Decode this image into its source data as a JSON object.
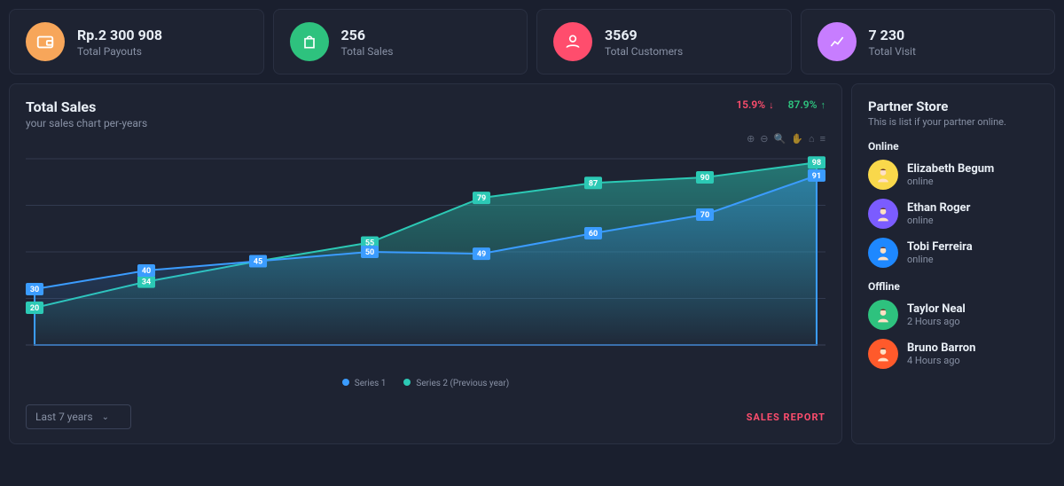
{
  "stats": [
    {
      "value": "Rp.2 300 908",
      "label": "Total Payouts",
      "icon": "wallet",
      "bg": "#f7a65a"
    },
    {
      "value": "256",
      "label": "Total Sales",
      "icon": "bag",
      "bg": "#2ec27e"
    },
    {
      "value": "3569",
      "label": "Total Customers",
      "icon": "user",
      "bg": "#ff4d6d"
    },
    {
      "value": "7 230",
      "label": "Total Visit",
      "icon": "chart",
      "bg": "#c77dff"
    }
  ],
  "chart": {
    "title": "Total Sales",
    "subtitle": "your sales chart per-years",
    "stat_down": "15.9%",
    "stat_up": "87.9%",
    "legend": {
      "series1": "Series 1",
      "series2": "Series 2 (Previous year)"
    },
    "period_selector": "Last 7 years",
    "report_link": "SALES REPORT"
  },
  "chart_data": {
    "type": "area",
    "x": [
      1,
      2,
      3,
      4,
      5,
      6,
      7,
      8
    ],
    "ylim": [
      0,
      100
    ],
    "series": [
      {
        "name": "Series 1 (blue)",
        "color": "#3b9cff",
        "values": [
          30,
          40,
          45,
          50,
          49,
          60,
          70,
          91
        ]
      },
      {
        "name": "Series 2 (teal)",
        "color": "#2cc9b5",
        "values": [
          20,
          34,
          45,
          55,
          79,
          87,
          90,
          98
        ]
      }
    ]
  },
  "partner": {
    "title": "Partner Store",
    "subtitle": "This is list if your partner online.",
    "online_label": "Online",
    "offline_label": "Offline",
    "online": [
      {
        "name": "Elizabeth Begum",
        "status": "online",
        "avatar_bg": "#f9d84b"
      },
      {
        "name": "Ethan Roger",
        "status": "online",
        "avatar_bg": "#7b5cff"
      },
      {
        "name": "Tobi Ferreira",
        "status": "online",
        "avatar_bg": "#1e88ff"
      }
    ],
    "offline": [
      {
        "name": "Taylor Neal",
        "status": "2 Hours ago",
        "avatar_bg": "#2ec27e"
      },
      {
        "name": "Bruno Barron",
        "status": "4 Hours ago",
        "avatar_bg": "#ff5a2b"
      }
    ]
  }
}
